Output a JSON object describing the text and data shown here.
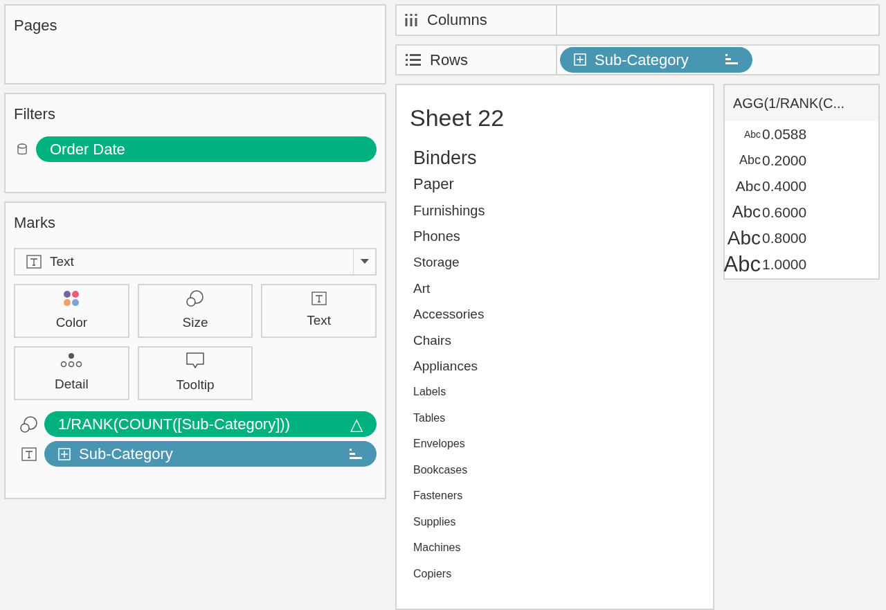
{
  "pages": {
    "title": "Pages"
  },
  "filters": {
    "title": "Filters",
    "pills": [
      {
        "label": "Order Date",
        "kind": "measure"
      }
    ]
  },
  "marks": {
    "title": "Marks",
    "mark_type": "Text",
    "cards": [
      {
        "label": "Color",
        "kind": "color"
      },
      {
        "label": "Size",
        "kind": "size"
      },
      {
        "label": "Text",
        "kind": "text"
      },
      {
        "label": "Detail",
        "kind": "detail"
      },
      {
        "label": "Tooltip",
        "kind": "tooltip"
      }
    ],
    "pills": [
      {
        "kind": "size",
        "pill": {
          "label": "1/RANK(COUNT([Sub-Category]))",
          "kind": "measure",
          "badge": "△"
        }
      },
      {
        "kind": "text",
        "pill": {
          "label": "Sub-Category",
          "kind": "dimension"
        }
      }
    ]
  },
  "columns_shelf": {
    "label": "Columns"
  },
  "rows_shelf": {
    "label": "Rows",
    "pills": [
      {
        "label": "Sub-Category",
        "kind": "dimension"
      }
    ]
  },
  "sheet": {
    "title": "Sheet 22",
    "items": [
      {
        "label": "Binders",
        "kind": "rank6"
      },
      {
        "label": "Paper",
        "kind": "rank5"
      },
      {
        "label": "Furnishings",
        "kind": "rank4"
      },
      {
        "label": "Phones",
        "kind": "rank4"
      },
      {
        "label": "Storage",
        "kind": "rank3"
      },
      {
        "label": "Art",
        "kind": "rank3"
      },
      {
        "label": "Accessories",
        "kind": "rank3"
      },
      {
        "label": "Chairs",
        "kind": "rank3"
      },
      {
        "label": "Appliances",
        "kind": "rank3"
      },
      {
        "label": "Labels",
        "kind": "rank1"
      },
      {
        "label": "Tables",
        "kind": "rank1"
      },
      {
        "label": "Envelopes",
        "kind": "rank1"
      },
      {
        "label": "Bookcases",
        "kind": "rank1"
      },
      {
        "label": "Fasteners",
        "kind": "rank1"
      },
      {
        "label": "Supplies",
        "kind": "rank1"
      },
      {
        "label": "Machines",
        "kind": "rank1"
      },
      {
        "label": "Copiers",
        "kind": "rank1"
      }
    ]
  },
  "legend": {
    "title": "AGG(1/RANK(C...",
    "rows": [
      {
        "sample": "Abc",
        "value": "0.0588",
        "kind": "rank1"
      },
      {
        "sample": "Abc",
        "value": "0.2000",
        "kind": "rank2"
      },
      {
        "sample": "Abc",
        "value": "0.4000",
        "kind": "rank3"
      },
      {
        "sample": "Abc",
        "value": "0.6000",
        "kind": "rank4"
      },
      {
        "sample": "Abc",
        "value": "0.8000",
        "kind": "rank5"
      },
      {
        "sample": "Abc",
        "value": "1.0000",
        "kind": "rank6"
      }
    ]
  }
}
